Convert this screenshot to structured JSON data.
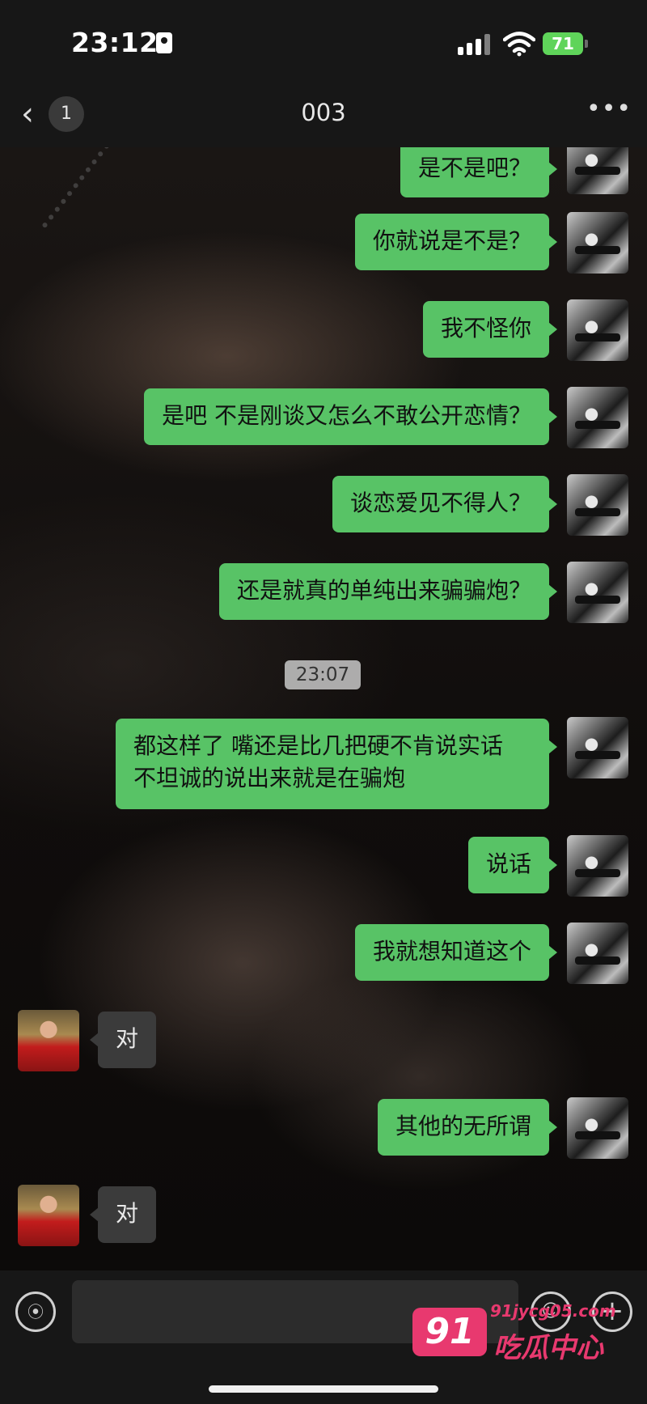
{
  "status_bar": {
    "time": "23:12",
    "battery": "71",
    "battery_color": "#5fd45a"
  },
  "nav": {
    "back_icon": "chevron-left-icon",
    "unread_count": "1",
    "title": "003",
    "more_icon": "ellipsis-icon"
  },
  "messages": [
    {
      "from": "me",
      "text": "是不是吧？"
    },
    {
      "from": "me",
      "text": "你就说是不是？"
    },
    {
      "from": "me",
      "text": "我不怪你"
    },
    {
      "from": "me",
      "text": "是吧 不是刚谈又怎么不敢公开恋情？"
    },
    {
      "from": "me",
      "text": "谈恋爱见不得人？"
    },
    {
      "from": "me",
      "text": "还是就真的单纯出来骗骗炮？"
    },
    {
      "timestamp": "23:07"
    },
    {
      "from": "me",
      "text": "都这样了 嘴还是比几把硬不肯说实话 不坦诚的说出来就是在骗炮"
    },
    {
      "from": "me",
      "text": "说话"
    },
    {
      "from": "me",
      "text": "我就想知道这个"
    },
    {
      "from": "other",
      "text": "对"
    },
    {
      "from": "me",
      "text": "其他的无所谓"
    },
    {
      "from": "other",
      "text": "对"
    }
  ],
  "input_bar": {
    "voice_icon": "voice-icon",
    "emoji_icon": "emoji-icon",
    "plus_icon": "plus-icon"
  },
  "watermark": {
    "logo": "91",
    "url": "91jycg05.com",
    "name": "吃瓜中心",
    "color": "#e8396f"
  },
  "colors": {
    "bubble_out": "#58c366",
    "bubble_in": "#3b3b3b",
    "bar_bg": "#171717"
  }
}
